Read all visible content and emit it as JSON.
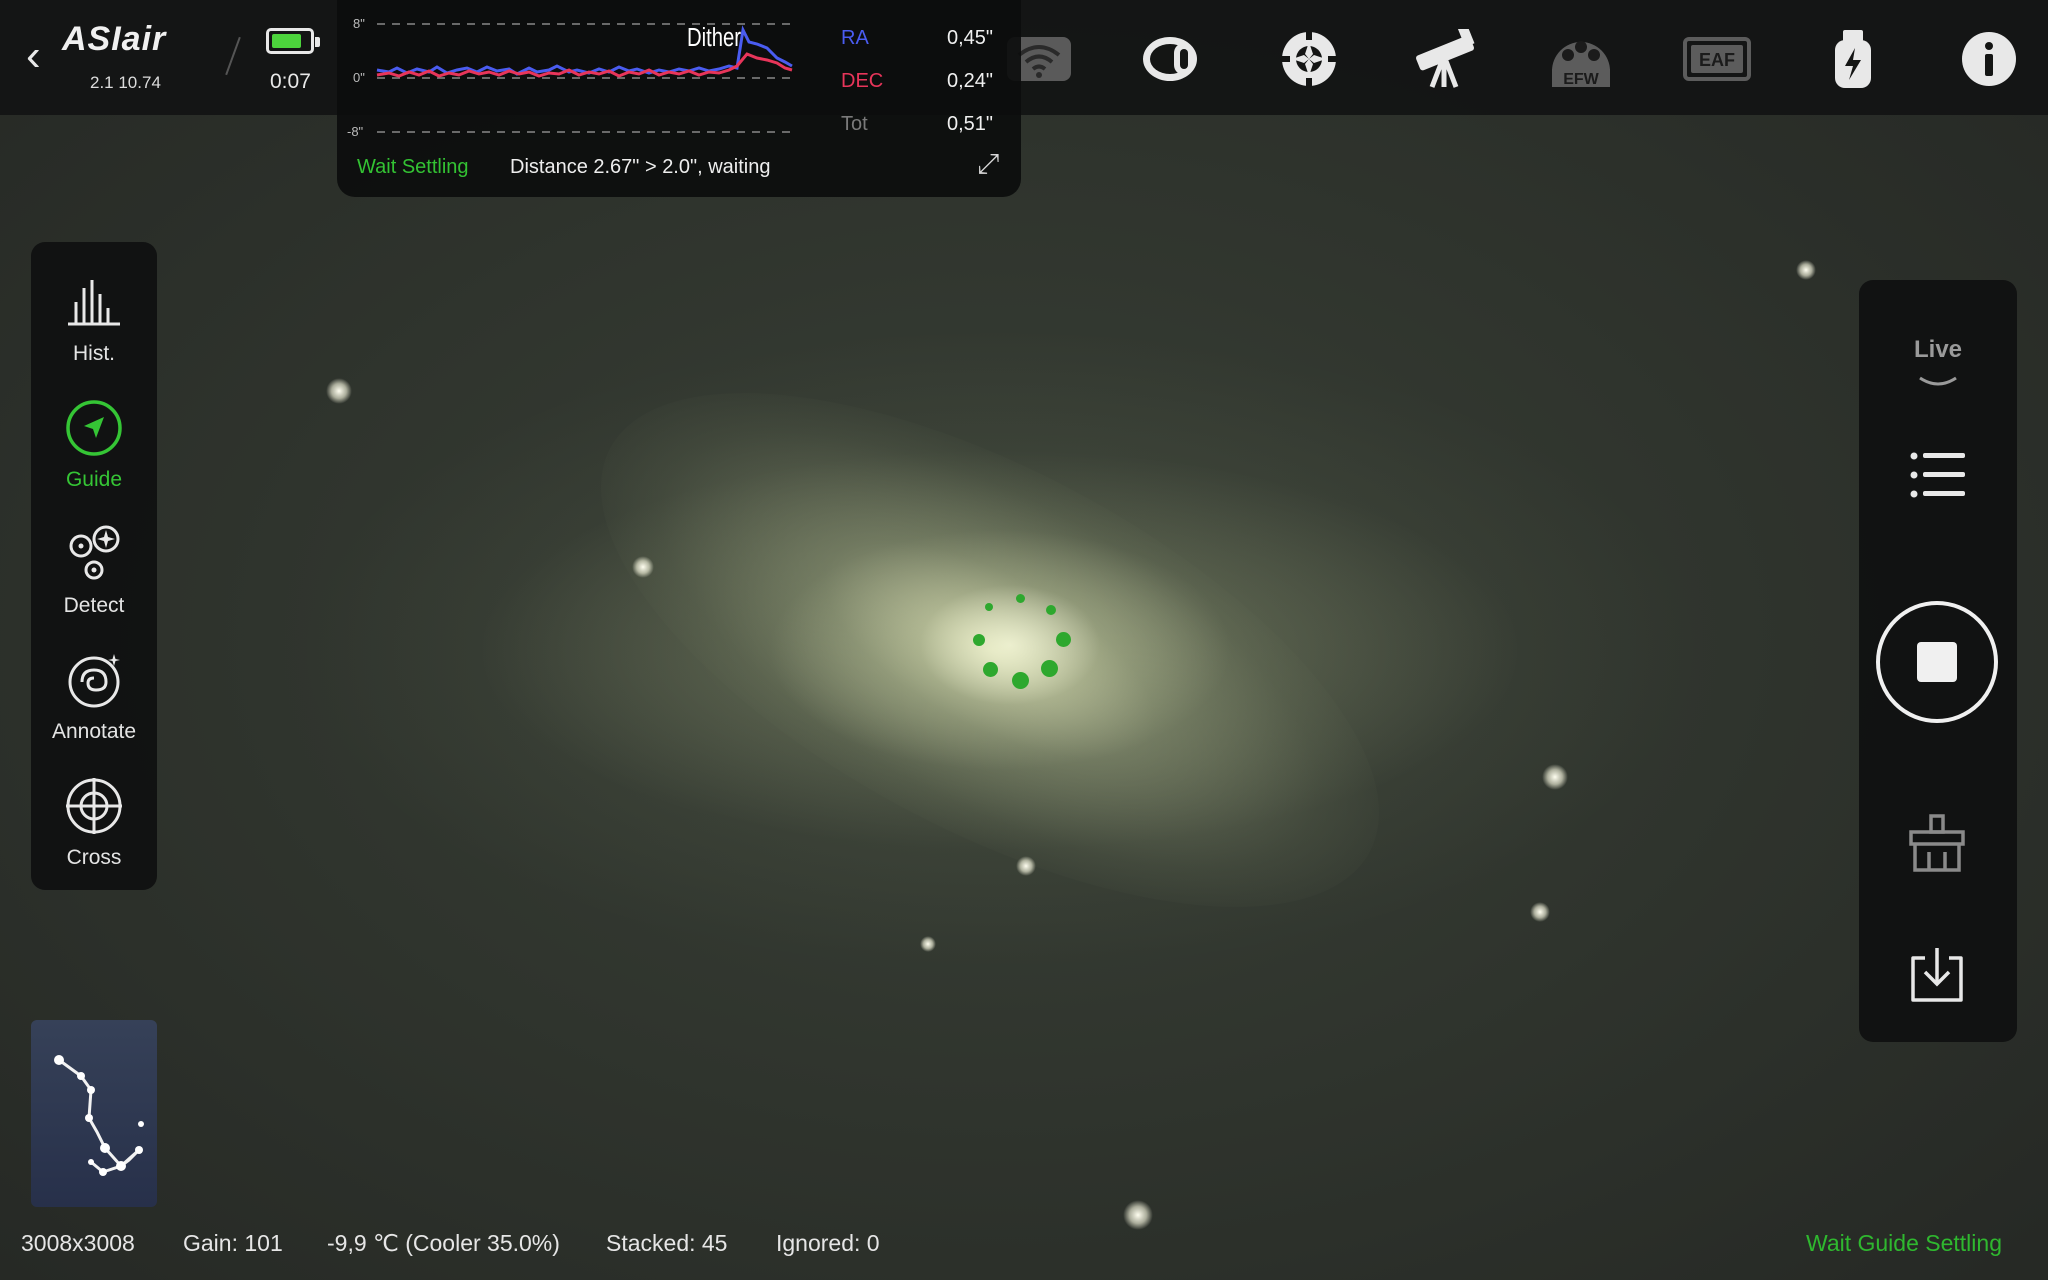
{
  "app": {
    "logo": "ASIair",
    "version": "2.1 10.74"
  },
  "topbar": {
    "timer": "0:07",
    "battery_level": 0.8,
    "icons": [
      "wifi-icon",
      "camera-icon",
      "guide-camera-icon",
      "telescope-icon",
      "efw-icon",
      "eaf-icon",
      "power-usb-icon",
      "info-icon"
    ],
    "efw_label": "EFW",
    "eaf_label": "EAF"
  },
  "guide": {
    "y_top": "8\"",
    "y_mid": "0\"",
    "y_bottom": "-8\"",
    "dither_label": "Dither",
    "ra_label": "RA",
    "ra_value": "0,45\"",
    "dec_label": "DEC",
    "dec_value": "0,24\"",
    "tot_label": "Tot",
    "tot_value": "0,51\"",
    "status": "Wait Settling",
    "message": "Distance 2.67\" > 2.0\", waiting",
    "colors": {
      "ra": "#4a5cf0",
      "dec": "#e8355a",
      "status": "#33c233"
    }
  },
  "left_tools": [
    {
      "label": "Hist.",
      "icon": "histogram-icon"
    },
    {
      "label": "Guide",
      "icon": "guide-arrow-icon",
      "active": true
    },
    {
      "label": "Detect",
      "icon": "detect-stars-icon"
    },
    {
      "label": "Annotate",
      "icon": "annotate-galaxy-icon"
    },
    {
      "label": "Cross",
      "icon": "crosshair-icon"
    }
  ],
  "right_panel": {
    "mode": "Live",
    "icons": [
      "list-icon",
      "stop-icon",
      "filter-clean-icon",
      "download-icon"
    ]
  },
  "status_bar": {
    "resolution": "3008x3008",
    "gain": "Gain: 101",
    "temperature": "-9,9 ℃ (Cooler 35.0%)",
    "stacked": "Stacked: 45",
    "ignored": "Ignored: 0",
    "state": "Wait Guide Settling"
  }
}
